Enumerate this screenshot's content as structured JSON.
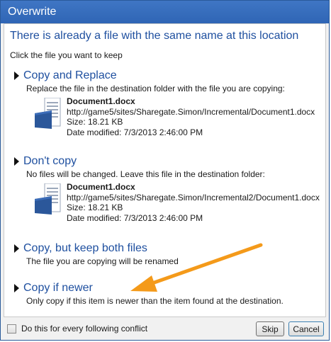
{
  "window": {
    "title": "Overwrite"
  },
  "dialog": {
    "heading": "There is already a file with the same name at this location",
    "instruction": "Click the file you want to keep"
  },
  "options": [
    {
      "label": "Copy and Replace",
      "description": "Replace the file in the destination folder with the file you are copying:",
      "file": {
        "name": "Document1.docx",
        "path": "http://game5/sites/Sharegate.Simon/Incremental/Document1.docx",
        "size": "Size: 18.21 KB",
        "modified": "Date modified: 7/3/2013 2:46:00 PM"
      }
    },
    {
      "label": "Don't copy",
      "description": "No files will be changed. Leave this file in the destination folder:",
      "file": {
        "name": "Document1.docx",
        "path": "http://game5/sites/Sharegate.Simon/Incremental2/Document1.docx",
        "size": "Size: 18.21 KB",
        "modified": "Date modified: 7/3/2013 2:46:00 PM"
      }
    },
    {
      "label": "Copy, but keep both files",
      "description": "The file you are copying will be renamed"
    },
    {
      "label": "Copy if newer",
      "description": "Only copy if this item is newer than the item found at the destination."
    }
  ],
  "footer": {
    "checkbox_label": "Do this for every following conflict",
    "checkbox_checked": false,
    "skip_label": "Skip",
    "cancel_label": "Cancel"
  },
  "icons": {
    "option_marker": "triangle-right-icon",
    "document": "word-document-icon",
    "annotation": "orange-arrow-icon"
  },
  "colors": {
    "titlebar": "#3a70bf",
    "link_blue": "#1e4f9f",
    "doc_blue": "#2b579a",
    "arrow_orange": "#f49a1a"
  }
}
